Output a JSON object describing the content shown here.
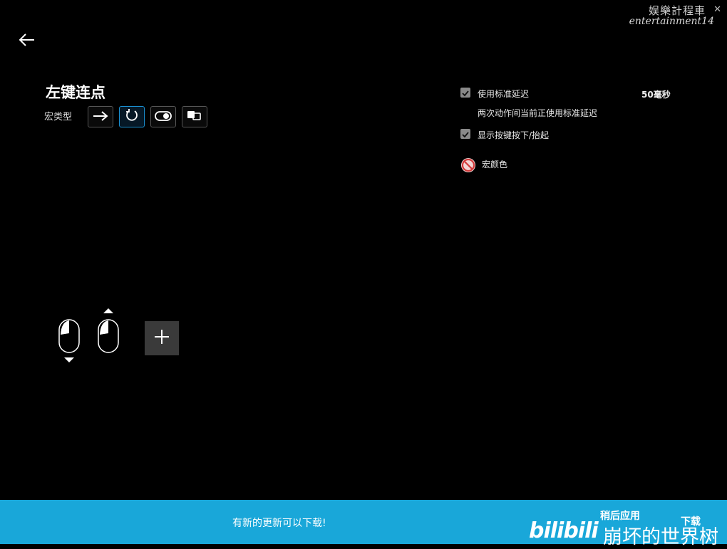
{
  "watermark": {
    "line1": "娱樂計程車",
    "line2": "entertainment14"
  },
  "window": {
    "close_glyph": "✕"
  },
  "header": {
    "back_icon": "back-arrow-icon"
  },
  "macro": {
    "title": "左键连点",
    "type_label": "宏类型",
    "type_buttons": [
      {
        "icon": "arrow-right-icon",
        "active": false
      },
      {
        "icon": "repeat-loop-icon",
        "active": true
      },
      {
        "icon": "toggle-icon",
        "active": false
      },
      {
        "icon": "sequence-icon",
        "active": false
      }
    ]
  },
  "settings": {
    "standard_delay_label": "使用标准延迟",
    "standard_delay_value": "50毫秒",
    "standard_delay_checked": true,
    "standard_delay_desc": "两次动作间当前正使用标准延迟",
    "show_keypress_label": "显示按键按下/抬起",
    "show_keypress_checked": true,
    "macro_color_label": "宏颜色"
  },
  "sequence": {
    "steps": [
      {
        "action": "left-click-press",
        "indicator": "down"
      },
      {
        "action": "left-click-release",
        "indicator": "up"
      }
    ],
    "add_glyph": "+"
  },
  "update_bar": {
    "message": "有新的更新可以下载!",
    "later_label": "稍后应用",
    "download_label": "下载"
  },
  "overlay": {
    "site_logo": "bilibili",
    "user_text": "崩坏的世界树"
  },
  "colors": {
    "accent": "#19a7d9",
    "active_border": "#1a8fd0",
    "background": "#000000"
  }
}
